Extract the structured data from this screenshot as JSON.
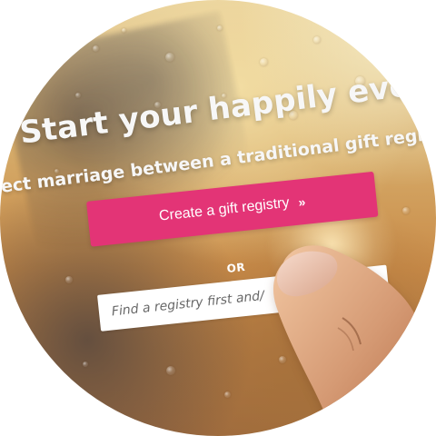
{
  "hero": {
    "headline": "Start your happily ever a",
    "subheadline": "ect marriage between a traditional gift registry an"
  },
  "cta": {
    "label": "Create a gift registry",
    "chevron": "»"
  },
  "divider": {
    "text": "OR"
  },
  "search": {
    "placeholder": "Find a registry first and/"
  },
  "icons": {
    "search": "search-icon",
    "finger": "finger-icon"
  },
  "colors": {
    "accent": "#e33476",
    "text_light": "#f7f7f7",
    "input_bg": "#ffffff"
  }
}
